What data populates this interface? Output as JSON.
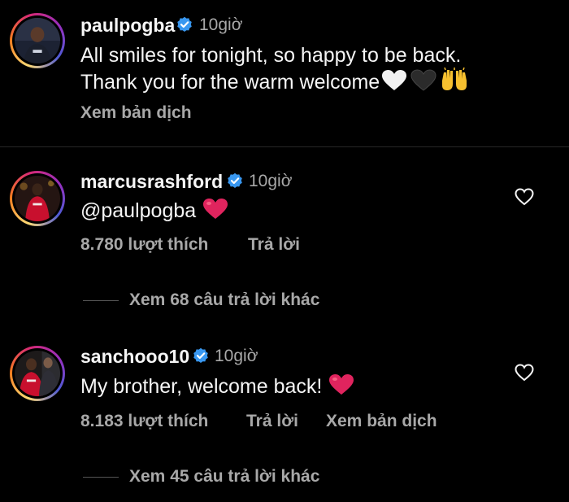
{
  "caption": {
    "username": "paulpogba",
    "time": "10giờ",
    "line1": "All smiles for tonight, so happy to be back.",
    "line2": "Thank you for the warm welcome",
    "translate": "Xem bản dịch"
  },
  "comments": [
    {
      "username": "marcusrashford",
      "time": "10giờ",
      "text": "@paulpogba",
      "likes": "8.780 lượt thích",
      "reply": "Trả lời",
      "view_replies": "Xem 68 câu trả lời khác"
    },
    {
      "username": "sanchooo10",
      "time": "10giờ",
      "text": "My brother, welcome back!",
      "likes": "8.183 lượt thích",
      "reply": "Trả lời",
      "translate": "Xem bản dịch",
      "view_replies": "Xem 45 câu trả lời khác"
    }
  ],
  "icons": {
    "verified": "verified-badge-icon",
    "like": "heart-outline-icon",
    "white_heart": "white-heart-emoji",
    "black_heart": "black-heart-emoji",
    "raised_hands": "raised-hands-emoji",
    "red_heart": "red-heart-emoji"
  },
  "colors": {
    "background": "#000000",
    "text": "#f5f5f5",
    "secondary": "#a8a8a8",
    "verified": "#3897f0",
    "red_heart": "#e0245e"
  }
}
